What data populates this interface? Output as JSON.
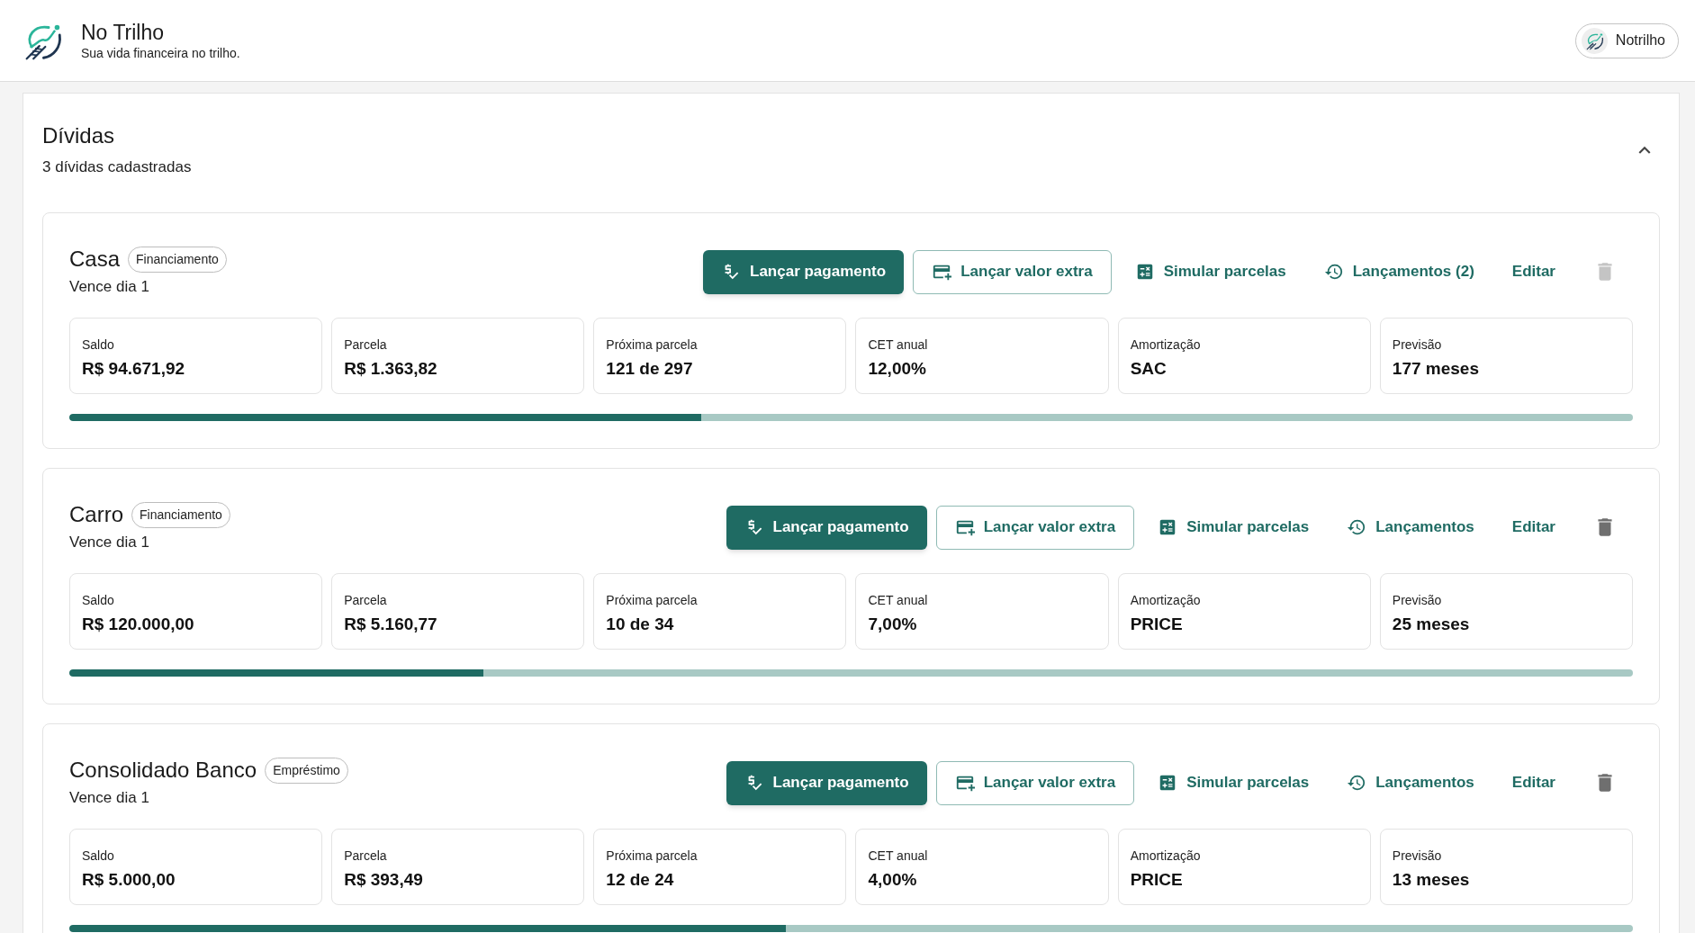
{
  "app_header": {
    "title": "No Trilho",
    "tagline": "Sua vida financeira no trilho.",
    "account_button": {
      "label": "Notrilho"
    }
  },
  "debts_panel": {
    "title": "Dívidas",
    "subtitle": "3 dívidas cadastradas",
    "expanded": true,
    "debts": [
      {
        "name": "Casa",
        "type_badge": "Financiamento",
        "due": "Vence dia 1",
        "actions": [
          {
            "kind": "pay",
            "label": "Lançar pagamento"
          },
          {
            "kind": "extra",
            "label": "Lançar valor extra"
          },
          {
            "kind": "simulate",
            "label": "Simular parcelas"
          },
          {
            "kind": "history",
            "label": "Lançamentos (2)"
          },
          {
            "kind": "edit",
            "label": "Editar"
          }
        ],
        "delete_button": {
          "disabled": true
        },
        "stats": [
          {
            "label": "Saldo",
            "value": "R$ 94.671,92"
          },
          {
            "label": "Parcela",
            "value": "R$ 1.363,82"
          },
          {
            "label": "Próxima parcela",
            "value": "121 de 297"
          },
          {
            "label": "CET anual",
            "value": "12,00%"
          },
          {
            "label": "Amortização",
            "value": "SAC"
          },
          {
            "label": "Previsão",
            "value": "177 meses"
          }
        ],
        "progress": {
          "level": 0.404
        }
      },
      {
        "name": "Carro",
        "type_badge": "Financiamento",
        "due": "Vence dia 1",
        "actions": [
          {
            "kind": "pay",
            "label": "Lançar pagamento"
          },
          {
            "kind": "extra",
            "label": "Lançar valor extra"
          },
          {
            "kind": "simulate",
            "label": "Simular parcelas"
          },
          {
            "kind": "history",
            "label": "Lançamentos"
          },
          {
            "kind": "edit",
            "label": "Editar"
          }
        ],
        "delete_button": {
          "disabled": false
        },
        "stats": [
          {
            "label": "Saldo",
            "value": "R$ 120.000,00"
          },
          {
            "label": "Parcela",
            "value": "R$ 5.160,77"
          },
          {
            "label": "Próxima parcela",
            "value": "10 de 34"
          },
          {
            "label": "CET anual",
            "value": "7,00%"
          },
          {
            "label": "Amortização",
            "value": "PRICE"
          },
          {
            "label": "Previsão",
            "value": "25 meses"
          }
        ],
        "progress": {
          "level": 0.265
        }
      },
      {
        "name": "Consolidado Banco",
        "type_badge": "Empréstimo",
        "due": "Vence dia 1",
        "actions": [
          {
            "kind": "pay",
            "label": "Lançar pagamento"
          },
          {
            "kind": "extra",
            "label": "Lançar valor extra"
          },
          {
            "kind": "simulate",
            "label": "Simular parcelas"
          },
          {
            "kind": "history",
            "label": "Lançamentos"
          },
          {
            "kind": "edit",
            "label": "Editar"
          }
        ],
        "delete_button": {
          "disabled": false
        },
        "stats": [
          {
            "label": "Saldo",
            "value": "R$ 5.000,00"
          },
          {
            "label": "Parcela",
            "value": "R$ 393,49"
          },
          {
            "label": "Próxima parcela",
            "value": "12 de 24"
          },
          {
            "label": "CET anual",
            "value": "4,00%"
          },
          {
            "label": "Amortização",
            "value": "PRICE"
          },
          {
            "label": "Previsão",
            "value": "13 meses"
          }
        ],
        "progress": {
          "level": 0.458
        }
      }
    ]
  }
}
